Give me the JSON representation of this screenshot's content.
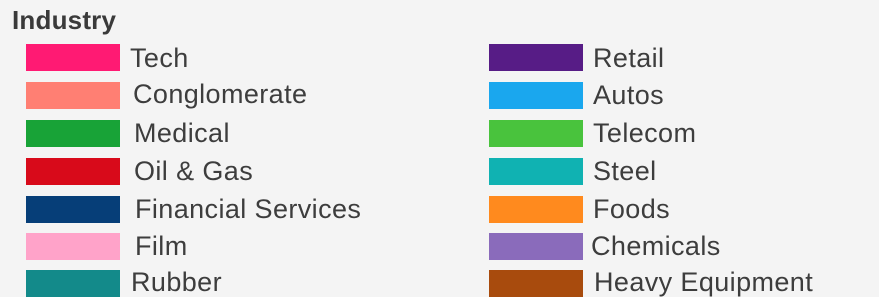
{
  "legend": {
    "title": "Industry",
    "items": [
      {
        "label": "Tech",
        "color": "#ff1a73"
      },
      {
        "label": "Conglomerate",
        "color": "#ff7f73"
      },
      {
        "label": "Medical",
        "color": "#18a337"
      },
      {
        "label": "Oil & Gas",
        "color": "#d80a1a"
      },
      {
        "label": "Financial Services",
        "color": "#063e78"
      },
      {
        "label": "Film",
        "color": "#ffa3c9"
      },
      {
        "label": "Rubber",
        "color": "#138a8a"
      },
      {
        "label": "Retail",
        "color": "#571c86"
      },
      {
        "label": "Autos",
        "color": "#1aa7ee"
      },
      {
        "label": "Telecom",
        "color": "#49c33d"
      },
      {
        "label": "Steel",
        "color": "#10b2b2"
      },
      {
        "label": "Foods",
        "color": "#ff8a1e"
      },
      {
        "label": "Chemicals",
        "color": "#8a6bbb"
      },
      {
        "label": "Heavy Equipment",
        "color": "#a84b0d"
      }
    ]
  }
}
